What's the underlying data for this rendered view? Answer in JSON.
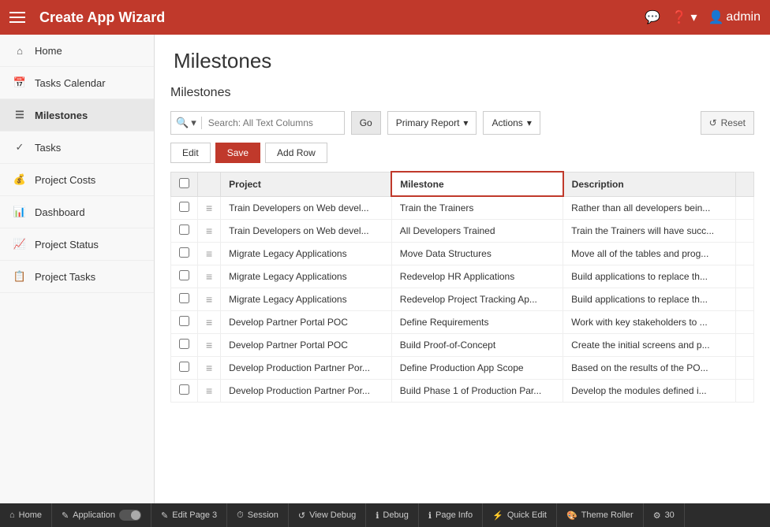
{
  "header": {
    "title": "Create App Wizard",
    "icons": {
      "chat": "💬",
      "help": "?",
      "user": "admin"
    }
  },
  "sidebar": {
    "items": [
      {
        "id": "home",
        "label": "Home",
        "icon": "⌂"
      },
      {
        "id": "tasks-calendar",
        "label": "Tasks Calendar",
        "icon": "📅"
      },
      {
        "id": "milestones",
        "label": "Milestones",
        "icon": "☰",
        "active": true
      },
      {
        "id": "tasks",
        "label": "Tasks",
        "icon": "✓"
      },
      {
        "id": "project-costs",
        "label": "Project Costs",
        "icon": "💰"
      },
      {
        "id": "dashboard",
        "label": "Dashboard",
        "icon": "📊"
      },
      {
        "id": "project-status",
        "label": "Project Status",
        "icon": "📈"
      },
      {
        "id": "project-tasks",
        "label": "Project Tasks",
        "icon": "📋"
      }
    ]
  },
  "page": {
    "title": "Milestones",
    "section_title": "Milestones"
  },
  "toolbar": {
    "search_placeholder": "Search: All Text Columns",
    "go_label": "Go",
    "primary_report_label": "Primary Report",
    "actions_label": "Actions",
    "reset_label": "Reset"
  },
  "action_row": {
    "edit_label": "Edit",
    "save_label": "Save",
    "add_row_label": "Add Row"
  },
  "table": {
    "columns": [
      "",
      "",
      "Project",
      "Milestone",
      "Description",
      ""
    ],
    "rows": [
      {
        "project": "Train Developers on Web devel...",
        "milestone": "Train the Trainers",
        "description": "Rather than all developers bein..."
      },
      {
        "project": "Train Developers on Web devel...",
        "milestone": "All Developers Trained",
        "description": "Train the Trainers will have succ..."
      },
      {
        "project": "Migrate Legacy Applications",
        "milestone": "Move Data Structures",
        "description": "Move all of the tables and prog..."
      },
      {
        "project": "Migrate Legacy Applications",
        "milestone": "Redevelop HR Applications",
        "description": "Build applications to replace th..."
      },
      {
        "project": "Migrate Legacy Applications",
        "milestone": "Redevelop Project Tracking Ap...",
        "description": "Build applications to replace th..."
      },
      {
        "project": "Develop Partner Portal POC",
        "milestone": "Define Requirements",
        "description": "Work with key stakeholders to ..."
      },
      {
        "project": "Develop Partner Portal POC",
        "milestone": "Build Proof-of-Concept",
        "description": "Create the initial screens and p..."
      },
      {
        "project": "Develop Production Partner Por...",
        "milestone": "Define Production App Scope",
        "description": "Based on the results of the PO..."
      },
      {
        "project": "Develop Production Partner Por...",
        "milestone": "Build Phase 1 of Production Par...",
        "description": "Develop the modules defined i..."
      }
    ]
  },
  "bottom_bar": {
    "items": [
      {
        "id": "home",
        "label": "Home",
        "icon": "⌂"
      },
      {
        "id": "application",
        "label": "Application",
        "icon": "✎",
        "has_toggle": true
      },
      {
        "id": "edit-page",
        "label": "Edit Page 3",
        "icon": "✎"
      },
      {
        "id": "session",
        "label": "Session",
        "icon": "⏱"
      },
      {
        "id": "view-debug",
        "label": "View Debug",
        "icon": "↺"
      },
      {
        "id": "debug",
        "label": "Debug",
        "icon": "ℹ"
      },
      {
        "id": "page-info",
        "label": "Page Info",
        "icon": "ℹ"
      },
      {
        "id": "quick-edit",
        "label": "Quick Edit",
        "icon": "⚡"
      },
      {
        "id": "theme-roller",
        "label": "Theme Roller",
        "icon": "🎨"
      },
      {
        "id": "settings",
        "label": "30",
        "icon": "⚙"
      }
    ]
  }
}
